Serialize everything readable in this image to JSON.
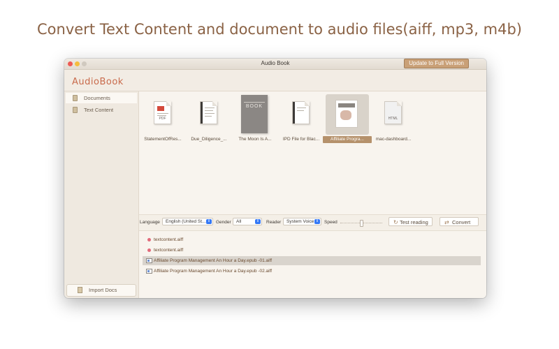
{
  "headline": "Convert Text Content and document to audio files(aiff, mp3, m4b)",
  "window": {
    "title": "Audio Book",
    "update_button": "Update to Full Version"
  },
  "brand": {
    "logo": "AudioBook",
    "accent_color": "#c96b4c"
  },
  "sidebar": {
    "items": [
      {
        "label": "Documents",
        "icon": "document-icon",
        "active": true
      },
      {
        "label": "Text Content",
        "icon": "text-icon",
        "active": false
      }
    ],
    "import_button": "Import Docs"
  },
  "documents": [
    {
      "label": "StatementOfRes...",
      "tag": "PDF"
    },
    {
      "label": "Due_Diligence_..."
    },
    {
      "label": "The Moon Is A...",
      "cover_text": "BOOK"
    },
    {
      "label": "IPD File for Blac..."
    },
    {
      "label": "Affiliate Progra...",
      "selected": true
    },
    {
      "label": "mac-dashboard...",
      "tag": "HTML"
    }
  ],
  "controls": {
    "language_label": "Language",
    "language_value": "English (United St...",
    "gender_label": "Gender",
    "gender_value": "All",
    "reader_label": "Reader",
    "reader_value": "System Voice",
    "speed_label": "Speed",
    "speed_value": 0.5,
    "test_button": "Test reading",
    "convert_button": "Convert"
  },
  "output_files": [
    {
      "name": "textcontent.aiff",
      "icon": "dot-icon"
    },
    {
      "name": "textcontent.aiff",
      "icon": "dot-icon"
    },
    {
      "name": "Affiliate Program Management An Hour a Day.epub -01.aiff",
      "icon": "image-file-icon",
      "selected": true
    },
    {
      "name": "Affiliate Program Management An Hour a Day.epub -02.aiff",
      "icon": "image-file-icon"
    }
  ]
}
